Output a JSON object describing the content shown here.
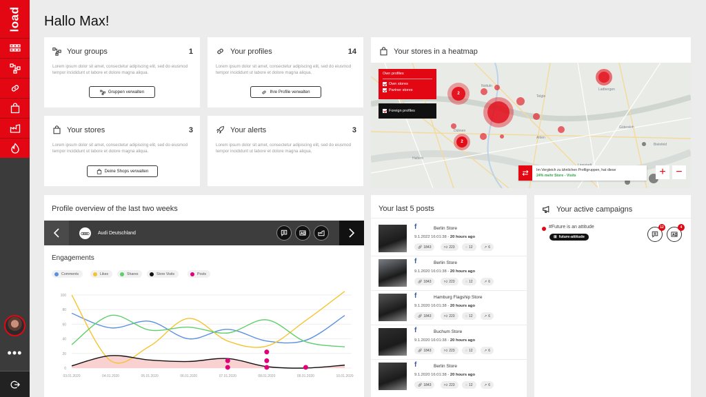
{
  "app": {
    "logo_text": "load"
  },
  "nav": [
    {
      "name": "nav-dashboard",
      "icon": "grid-icon"
    },
    {
      "name": "nav-groups",
      "icon": "network-icon"
    },
    {
      "name": "nav-profiles",
      "icon": "link-icon"
    },
    {
      "name": "nav-stores",
      "icon": "bag-icon"
    },
    {
      "name": "nav-campaigns",
      "icon": "factory-icon"
    },
    {
      "name": "nav-alerts",
      "icon": "flame-icon"
    }
  ],
  "greeting": "Hallo Max!",
  "lorem": "Lorem ipsum dolor sit amet, consectetur adipiscing elit, sed do eiusmod tempor incididunt ut labore et dolore magna aliqua.",
  "groups": {
    "title": "Your groups",
    "count": "1",
    "button": "Gruppen verwalten"
  },
  "profiles": {
    "title": "Your profiles",
    "count": "14",
    "button": "Ihre Profile verwalten"
  },
  "stores": {
    "title": "Your stores",
    "count": "3",
    "button": "Deine Shops verwalten"
  },
  "alerts": {
    "title": "Your alerts",
    "count": "3"
  },
  "heatmap": {
    "title": "Your stores in a heatmap",
    "legend_header": "Own profiles",
    "legend_own": "Own stores",
    "legend_partner": "Partner stores",
    "legend_foreign": "Foreign profiles",
    "cluster_1": "2",
    "cluster_2": "2",
    "compare_line1": "Im Vergleich zu ähnlichen Profilgruppen, hat diese",
    "compare_line2": "24% mehr Store - Visits",
    "zoom_in": "+",
    "zoom_out": "−"
  },
  "overview": {
    "title": "Profile overview of the last two weeks",
    "profile_name": "Audi Deutschland",
    "engagements": "Engagements"
  },
  "chart_data": {
    "type": "line",
    "title": "Engagements",
    "x": [
      "03.01.2020",
      "04.01.2020",
      "05.01.2020",
      "06.01.2020",
      "07.01.2020",
      "08.01.2020",
      "09.01.2020",
      "10.01.2020"
    ],
    "ylim": [
      0,
      100
    ],
    "yticks": [
      "100",
      "80",
      "60",
      "40",
      "20",
      "0"
    ],
    "series": [
      {
        "name": "Comments",
        "color": "#5b8fe0",
        "values": [
          75,
          55,
          64,
          40,
          53,
          37,
          38,
          72
        ]
      },
      {
        "name": "Likes",
        "color": "#f4c430",
        "values": [
          100,
          10,
          30,
          68,
          37,
          30,
          65,
          105
        ]
      },
      {
        "name": "Shares",
        "color": "#5ccf6a",
        "values": [
          32,
          72,
          52,
          56,
          48,
          66,
          36,
          29
        ]
      },
      {
        "name": "Store Visits",
        "color": "#111111",
        "values": [
          3,
          17,
          11,
          9,
          13,
          2,
          0,
          4
        ]
      },
      {
        "name": "Posts",
        "color": "#e0007a",
        "values": []
      }
    ],
    "post_points": [
      {
        "x": 4,
        "y": 10
      },
      {
        "x": 4,
        "y": 1
      },
      {
        "x": 5,
        "y": 22
      },
      {
        "x": 5,
        "y": 10
      },
      {
        "x": 5,
        "y": 1
      },
      {
        "x": 6,
        "y": 1
      }
    ],
    "grid": true,
    "legend": "top-left"
  },
  "posts": {
    "title": "Your last 5 posts",
    "items": [
      {
        "store": "Berlin Store",
        "date": "9.1.2022 16:01:38 - ",
        "ago": "20 hours ago",
        "clicks": "1843",
        "likes": "223",
        "comments": "12",
        "shares": "6"
      },
      {
        "store": "Berlin Store",
        "date": "9.1.2020 16:01:38 - ",
        "ago": "20 hours ago",
        "clicks": "1843",
        "likes": "223",
        "comments": "12",
        "shares": "6"
      },
      {
        "store": "Hamburg Flagship Store",
        "date": "9.1.2020 16:01:38 - ",
        "ago": "20 hours ago",
        "clicks": "1843",
        "likes": "223",
        "comments": "12",
        "shares": "6"
      },
      {
        "store": "Buchum Store",
        "date": "9.1.2020 16:01:38 - ",
        "ago": "20 hours ago",
        "clicks": "1843",
        "likes": "223",
        "comments": "12",
        "shares": "6"
      },
      {
        "store": "Berlin Store",
        "date": "9.1.2020 16:01:38 - ",
        "ago": "20 hours ago",
        "clicks": "1843",
        "likes": "223",
        "comments": "12",
        "shares": "6"
      }
    ]
  },
  "campaigns": {
    "title": "Your active campaigns",
    "name": "#Future is an attitude",
    "tag": "future-attitude",
    "badge_posts": "12",
    "badge_media": "4"
  },
  "colors": {
    "accent": "#e30613",
    "sidebar": "#3b3b3b",
    "positive": "#2fa04a"
  }
}
